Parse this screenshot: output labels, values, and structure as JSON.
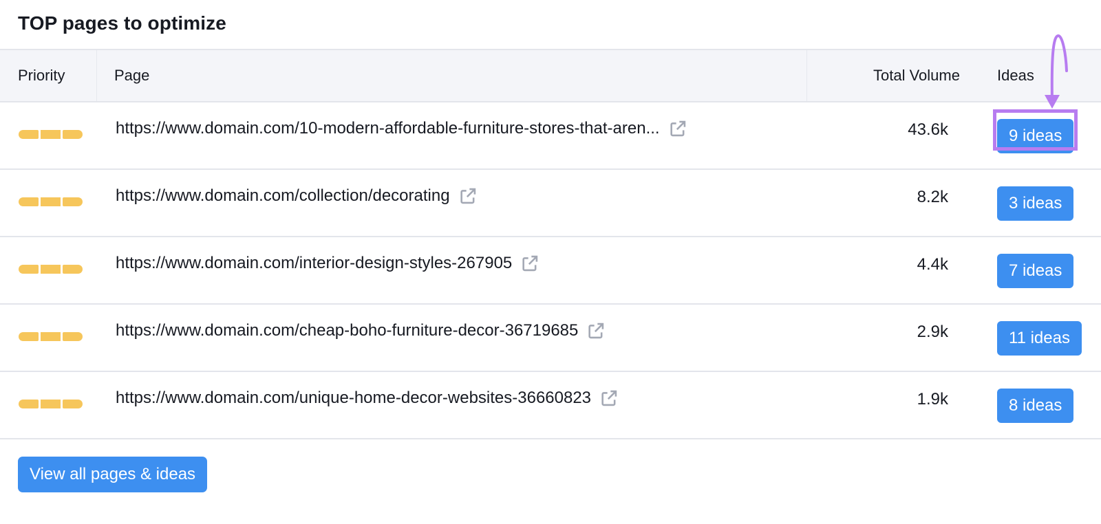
{
  "widget": {
    "title": "TOP pages to optimize"
  },
  "columns": {
    "priority": "Priority",
    "page": "Page",
    "volume": "Total Volume",
    "ideas": "Ideas"
  },
  "rows": [
    {
      "priority_level": 3,
      "url": "https://www.domain.com/10-modern-affordable-furniture-stores-that-aren...",
      "volume": "43.6k",
      "ideas": "9 ideas",
      "highlighted": true
    },
    {
      "priority_level": 3,
      "url": "https://www.domain.com/collection/decorating",
      "volume": "8.2k",
      "ideas": "3 ideas"
    },
    {
      "priority_level": 3,
      "url": "https://www.domain.com/interior-design-styles-267905",
      "volume": "4.4k",
      "ideas": "7 ideas"
    },
    {
      "priority_level": 3,
      "url": "https://www.domain.com/cheap-boho-furniture-decor-36719685",
      "volume": "2.9k",
      "ideas": "11 ideas"
    },
    {
      "priority_level": 3,
      "url": "https://www.domain.com/unique-home-decor-websites-36660823",
      "volume": "1.9k",
      "ideas": "8 ideas"
    }
  ],
  "footer": {
    "view_all_label": "View all pages & ideas"
  },
  "colors": {
    "priority": "#f6c65b",
    "button": "#3d8ff0",
    "annotation": "#b77cf0",
    "external_icon": "#a3a8b4"
  },
  "icons": {
    "external_link": "external-link-icon"
  }
}
